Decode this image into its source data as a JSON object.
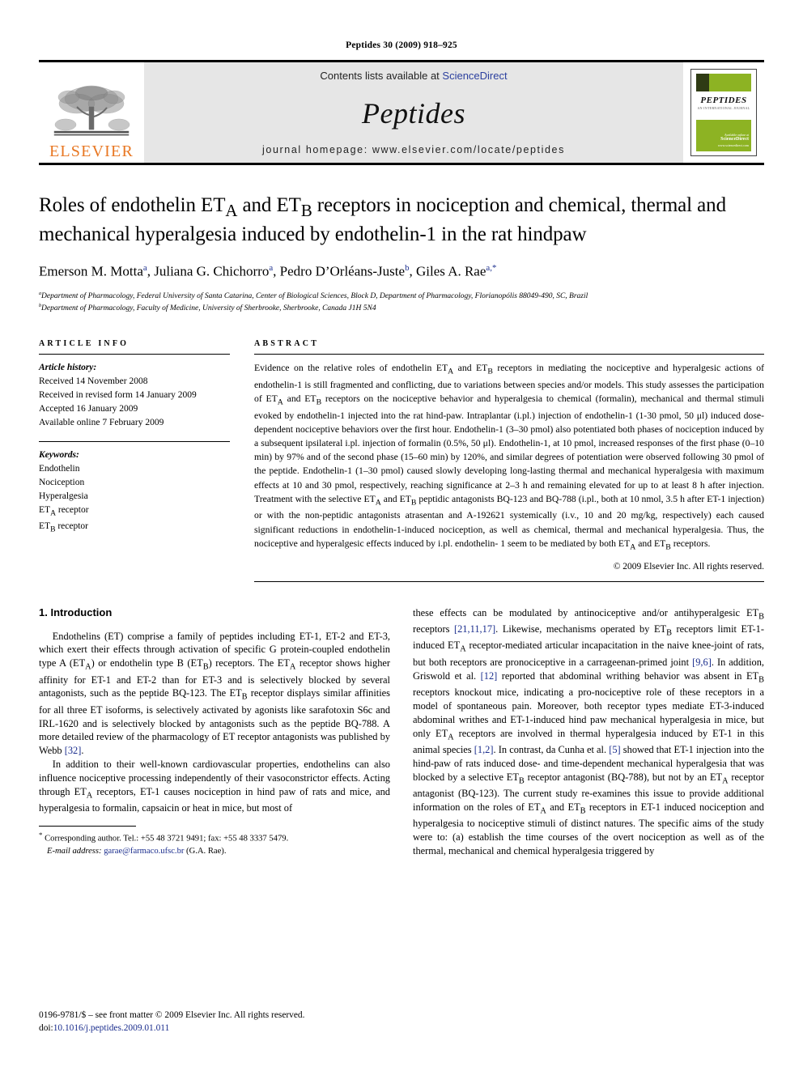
{
  "running_head": "Peptides 30 (2009) 918–925",
  "masthead": {
    "publisher_name": "ELSEVIER",
    "contents_prefix": "Contents lists available at ",
    "contents_link": "ScienceDirect",
    "journal_name": "Peptides",
    "homepage": "journal homepage: www.elsevier.com/locate/peptides",
    "cover": {
      "title": "PEPTIDES",
      "subtitle": "AN INTERNATIONAL JOURNAL",
      "sciencedirect_label": "Available online at",
      "sciencedirect_brand": "ScienceDirect",
      "sciencedirect_url": "www.sciencedirect.com",
      "band_color": "#8db323"
    }
  },
  "article": {
    "title_line1": "Roles of endothelin ET",
    "title": "Roles of endothelin ETA and ETB receptors in nociception and chemical, thermal and mechanical hyperalgesia induced by endothelin-1 in the rat hindpaw",
    "authors": [
      {
        "name": "Emerson M. Motta",
        "sup": "a"
      },
      {
        "name": "Juliana G. Chichorro",
        "sup": "a"
      },
      {
        "name": "Pedro D’Orléans-Juste",
        "sup": "b"
      },
      {
        "name": "Giles A. Rae",
        "sup": "a,*"
      }
    ],
    "affiliations": [
      {
        "marker": "a",
        "text": "Department of Pharmacology, Federal University of Santa Catarina, Center of Biological Sciences, Block D, Department of Pharmacology, Florianopólis 88049-490, SC, Brazil"
      },
      {
        "marker": "b",
        "text": "Department of Pharmacology, Faculty of Medicine, University of Sherbrooke, Sherbrooke, Canada J1H 5N4"
      }
    ]
  },
  "article_info": {
    "heading": "ARTICLE INFO",
    "history_label": "Article history:",
    "history": [
      "Received 14 November 2008",
      "Received in revised form 14 January 2009",
      "Accepted 16 January 2009",
      "Available online 7 February 2009"
    ],
    "keywords_label": "Keywords:",
    "keywords": [
      "Endothelin",
      "Nociception",
      "Hyperalgesia",
      "ETA receptor",
      "ETB receptor"
    ]
  },
  "abstract": {
    "heading": "ABSTRACT",
    "text": "Evidence on the relative roles of endothelin ETA and ETB receptors in mediating the nociceptive and hyperalgesic actions of endothelin-1 is still fragmented and conflicting, due to variations between species and/or models. This study assesses the participation of ETA and ETB receptors on the nociceptive behavior and hyperalgesia to chemical (formalin), mechanical and thermal stimuli evoked by endothelin-1 injected into the rat hind-paw. Intraplantar (i.pl.) injection of endothelin-1 (1-30 pmol, 50 μl) induced dose-dependent nociceptive behaviors over the first hour. Endothelin-1 (3–30 pmol) also potentiated both phases of nociception induced by a subsequent ipsilateral i.pl. injection of formalin (0.5%, 50 μl). Endothelin-1, at 10 pmol, increased responses of the first phase (0–10 min) by 97% and of the second phase (15–60 min) by 120%, and similar degrees of potentiation were observed following 30 pmol of the peptide. Endothelin-1 (1–30 pmol) caused slowly developing long-lasting thermal and mechanical hyperalgesia with maximum effects at 10 and 30 pmol, respectively, reaching significance at 2–3 h and remaining elevated for up to at least 8 h after injection. Treatment with the selective ETA and ETB peptidic antagonists BQ-123 and BQ-788 (i.pl., both at 10 nmol, 3.5 h after ET-1 injection) or with the non-peptidic antagonists atrasentan and A-192621 systemically (i.v., 10 and 20 mg/kg, respectively) each caused significant reductions in endothelin-1-induced nociception, as well as chemical, thermal and mechanical hyperalgesia. Thus, the nociceptive and hyperalgesic effects induced by i.pl. endothelin-1 seem to be mediated by both ETA and ETB receptors.",
    "copyright": "© 2009 Elsevier Inc. All rights reserved."
  },
  "introduction": {
    "heading": "1. Introduction",
    "left_paragraphs": [
      "Endothelins (ET) comprise a family of peptides including ET-1, ET-2 and ET-3, which exert their effects through activation of specific G protein-coupled endothelin type A (ETA) or endothelin type B (ETB) receptors. The ETA receptor shows higher affinity for ET-1 and ET-2 than for ET-3 and is selectively blocked by several antagonists, such as the peptide BQ-123. The ETB receptor displays similar affinities for all three ET isoforms, is selectively activated by agonists like sarafotoxin S6c and IRL-1620 and is selectively blocked by antagonists such as the peptide BQ-788. A more detailed review of the pharmacology of ET receptor antagonists was published by Webb [32].",
      "In addition to their well-known cardiovascular properties, endothelins can also influence nociceptive processing independently of their vasoconstrictor effects. Acting through ETA receptors, ET-1 causes nociception in hind paw of rats and mice, and hyperalgesia to formalin, capsaicin or heat in mice, but most of"
    ],
    "right_paragraph": "these effects can be modulated by antinociceptive and/or antihyperalgesic ETB receptors [21,11,17]. Likewise, mechanisms operated by ETB receptors limit ET-1-induced ETA receptor-mediated articular incapacitation in the naive knee-joint of rats, but both receptors are pronociceptive in a carrageenan-primed joint [9,6]. In addition, Griswold et al. [12] reported that abdominal writhing behavior was absent in ETB receptors knockout mice, indicating a pro-nociceptive role of these receptors in a model of spontaneous pain. Moreover, both receptor types mediate ET-3-induced abdominal writhes and ET-1-induced hind paw mechanical hyperalgesia in mice, but only ETA receptors are involved in thermal hyperalgesia induced by ET-1 in this animal species [1,2]. In contrast, da Cunha et al. [5] showed that ET-1 injection into the hind-paw of rats induced dose- and time-dependent mechanical hyperalgesia that was blocked by a selective ETB receptor antagonist (BQ-788), but not by an ETA receptor antagonist (BQ-123). The current study re-examines this issue to provide additional information on the roles of ETA and ETB receptors in ET-1 induced nociception and hyperalgesia to nociceptive stimuli of distinct natures. The specific aims of the study were to: (a) establish the time courses of the overt nociception as well as of the thermal, mechanical and chemical hyperalgesia triggered by"
  },
  "footnotes": {
    "corresponding": "Corresponding author. Tel.: +55 48 3721 9491; fax: +55 48 3337 5479.",
    "email_label": "E-mail address:",
    "email": "garae@farmaco.ufsc.br",
    "email_owner": "(G.A. Rae)."
  },
  "imprint": {
    "line1": "0196-9781/$ – see front matter © 2009 Elsevier Inc. All rights reserved.",
    "doi_label": "doi:",
    "doi": "10.1016/j.peptides.2009.01.011"
  },
  "colors": {
    "link": "#1a2d8d",
    "elsevier_orange": "#E87722",
    "band_gray": "#e6e6e6"
  }
}
